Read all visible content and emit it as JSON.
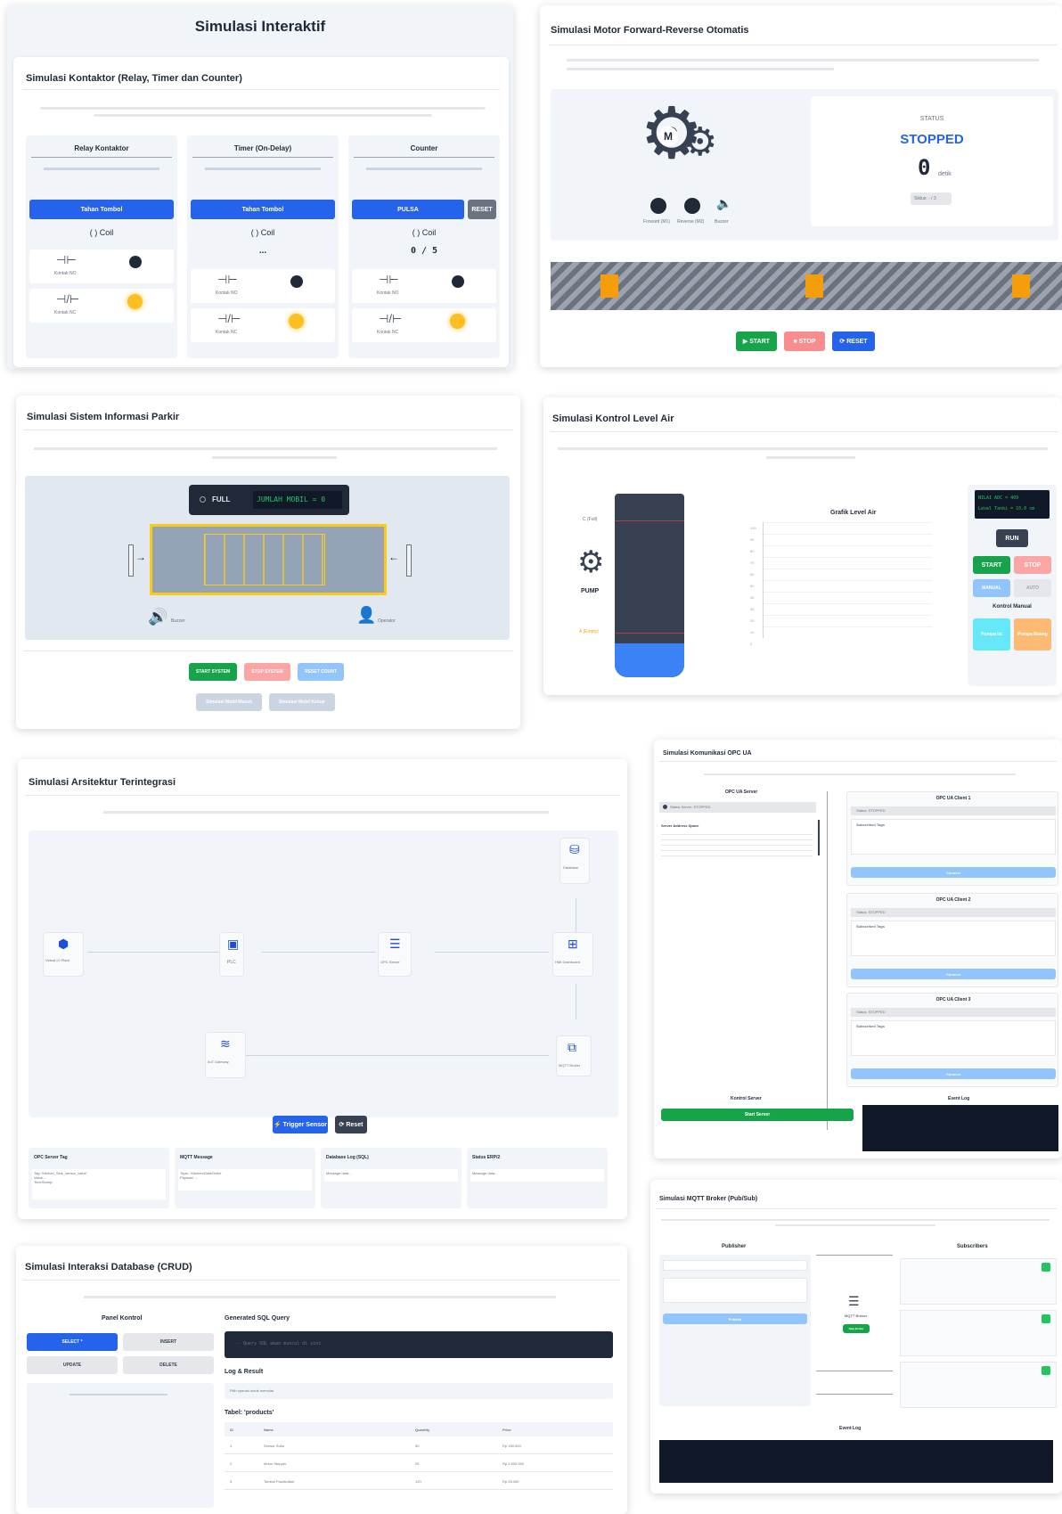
{
  "p1": {
    "page_title": "Simulasi Interaktif",
    "title": "Simulasi Kontaktor (Relay, Timer dan Counter)",
    "cols": [
      {
        "name": "Relay Kontaktor",
        "button": "Tahan Tombol",
        "coil": "( ) Coil",
        "no": "Kontak NO",
        "nc": "Kontak NC"
      },
      {
        "name": "Timer (On-Delay)",
        "button": "Tahan Tombol",
        "coil": "( ) Coil",
        "counter": "...",
        "no": "Kontak NO",
        "nc": "Kontak NC"
      },
      {
        "name": "Counter",
        "button": "PULSA",
        "reset": "RESET",
        "coil": "( ) Coil",
        "counter": "0 / 5",
        "no": "Kontak NO",
        "nc": "Kontak NC"
      }
    ]
  },
  "p2": {
    "title": "Simulasi Motor Forward-Reverse Otomatis",
    "motor_letter": "M",
    "lamps": [
      "Forward (M1)",
      "Reverse (M2)",
      "Buzzer"
    ],
    "status_label": "STATUS",
    "status": "STOPPED",
    "time": "0",
    "time_unit": "detik",
    "step": "Siklus: - / 3",
    "buttons": [
      "▶ START",
      "■ STOP",
      "⟳ RESET"
    ]
  },
  "p3": {
    "title": "Simulasi Sistem Informasi Parkir",
    "full": "FULL",
    "display": "JUMLAH MOBIL = 0",
    "buzzer": "Buzzer",
    "operator": "Operator",
    "buttons": [
      "START SYSTEM",
      "STOP SYSTEM",
      "RESET COUNT",
      "Simulasi Mobil Masuk",
      "Simulasi Mobil Keluar"
    ]
  },
  "p4": {
    "title": "Simulasi Kontrol Level Air",
    "high": "C (Full)",
    "low": "A (Empty)",
    "pump": "PUMP",
    "chart_title": "Grafik Level Air",
    "lcd1": "NILAI ADC = 409",
    "lcd2": "Level Tanki = 10.0 cm",
    "run": "RUN",
    "buttons": [
      "START",
      "STOP",
      "MANUAL",
      "AUTO"
    ],
    "manual_label": "Kontrol Manual",
    "manual_buttons": [
      "Pompa Isi",
      "Pompa Buang"
    ]
  },
  "p5": {
    "title": "Simulasi Arsitektur Terintegrasi",
    "nodes": {
      "plant": "Virtual IO Plant",
      "plc": "PLC",
      "opc": "OPC Server",
      "hmi": "HMI Dashboard",
      "db": "Database",
      "mqtt": "MQTT Broker",
      "iiot": "IIoT Gateway"
    },
    "buttons": [
      "⚡ Trigger Sensor",
      "⟳ Reset"
    ],
    "info": [
      {
        "label": "OPC Server Tag",
        "text": "Tag: 'Kitchen_Sink_sensor_value'\nValue: -\nTimeStamp:"
      },
      {
        "label": "MQTT Message",
        "text": "Topic: 'Kitchen/Data/Delta'\nPayload: ..."
      },
      {
        "label": "Database Log (SQL)",
        "text": "Message data..."
      },
      {
        "label": "Status ERP/2",
        "text": "Message data..."
      }
    ]
  },
  "p6": {
    "title": "Simulasi Komunikasi OPC UA",
    "server": "OPC UA Server",
    "server_status": "Status Server: STOPPED",
    "server_values": "Server Address Space",
    "clients": [
      {
        "name": "OPC UA Client 1",
        "status": "Status: STOPPED",
        "sub": "Subscribed Tags",
        "button": "Connect"
      },
      {
        "name": "OPC UA Client 2",
        "status": "Status: STOPPED",
        "sub": "Subscribed Tags",
        "button": "Connect"
      },
      {
        "name": "OPC UA Client 3",
        "status": "Status: STOPPED",
        "sub": "Subscribed Tags",
        "button": "Connect"
      }
    ],
    "server_control": "Kontrol Server",
    "start_server": "Start Server",
    "log": "Event Log"
  },
  "p7": {
    "title": "Simulasi Interaksi Database (CRUD)",
    "panel": "Panel Kontrol",
    "ops": [
      "SELECT *",
      "INSERT",
      "UPDATE",
      "DELETE"
    ],
    "sql_label": "Generated SQL Query",
    "sql": "-- Query SQL akan muncul di sini",
    "log_label": "Log & Result",
    "log": "Pilih operasi untuk memulai.",
    "table_label": "Tabel: 'products'",
    "cols": [
      "ID",
      "Name",
      "Quantity",
      "Price"
    ],
    "rows": [
      [
        "1",
        "Sensor Suhu",
        "50",
        "Rp 150.000"
      ],
      [
        "2",
        "Motor Stepper",
        "25",
        "Rp 2.500.000"
      ],
      [
        "3",
        "Tombol Pushbutton",
        "120",
        "Rp 25.000"
      ]
    ]
  },
  "p8": {
    "title": "Simulasi MQTT Broker (Pub/Sub)",
    "publisher": "Publisher",
    "subscribers": "Subscribers",
    "broker": "MQTT Broker",
    "broker_status": "Siap Broker",
    "publish": "Publish",
    "log": "Event Log"
  }
}
